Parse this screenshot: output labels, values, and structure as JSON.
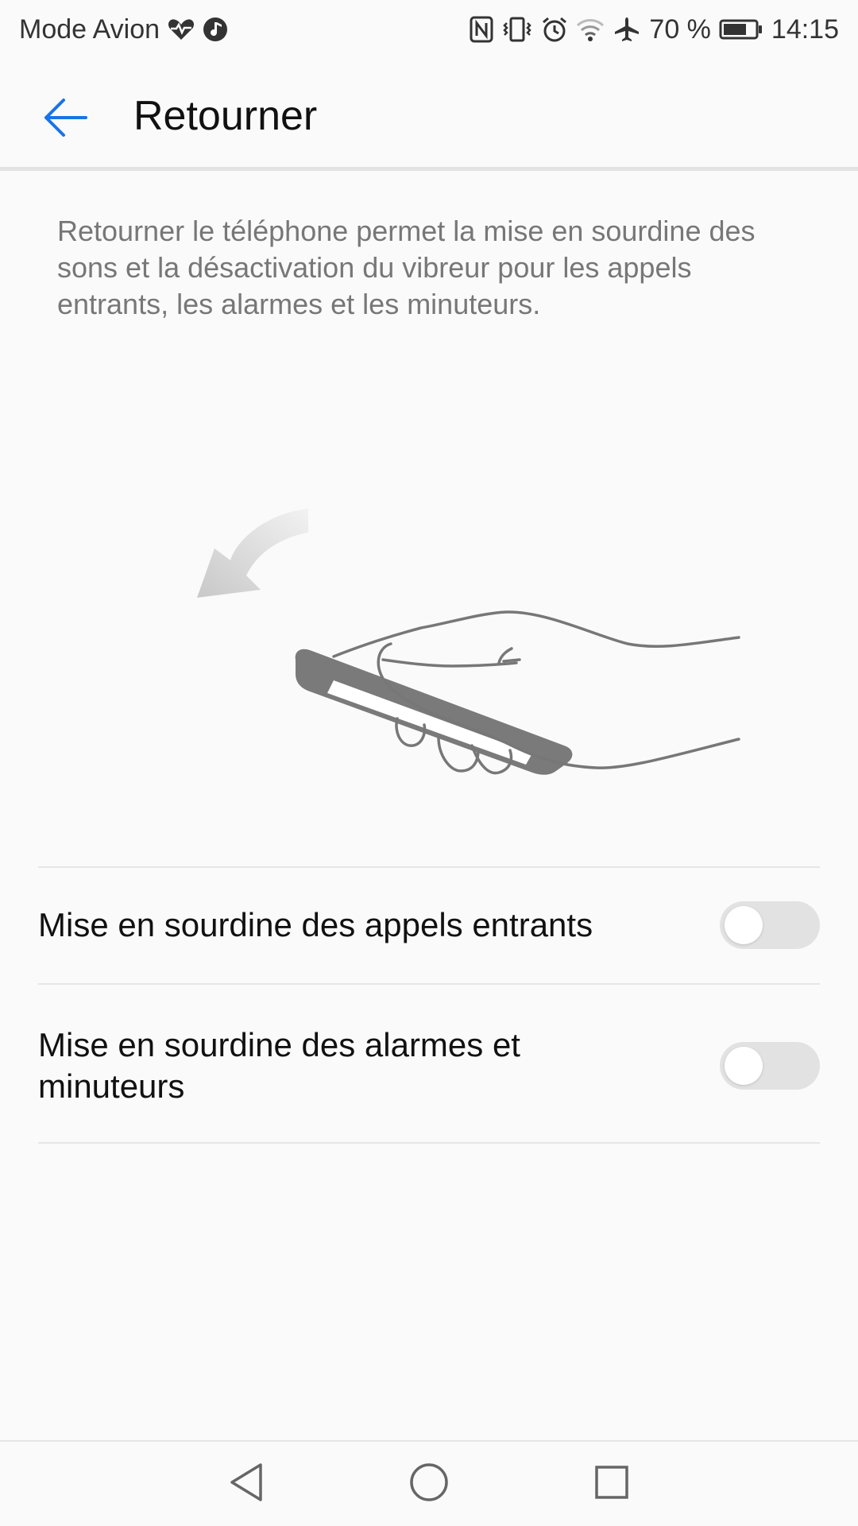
{
  "status_bar": {
    "left_text": "Mode Avion",
    "battery_percent": "70 %",
    "time": "14:15",
    "icons": [
      "heart-rate-icon",
      "music-icon",
      "nfc-icon",
      "vibrate-icon",
      "alarm-icon",
      "wifi-icon",
      "airplane-icon",
      "battery-icon"
    ]
  },
  "app_bar": {
    "title": "Retourner",
    "back_icon": "back-arrow-icon",
    "accent_color": "#1a73e8"
  },
  "description": "Retourner le téléphone permet la mise en sourdine des sons et la désactivation du vibreur pour les appels entrants, les alarmes et les minuteurs.",
  "settings": [
    {
      "label": "Mise en sourdine des appels entrants",
      "enabled": false
    },
    {
      "label": "Mise en sourdine des alarmes et minuteurs",
      "enabled": false
    }
  ],
  "nav_bar": {
    "icons": [
      "back-triangle-icon",
      "home-circle-icon",
      "recents-square-icon"
    ]
  }
}
